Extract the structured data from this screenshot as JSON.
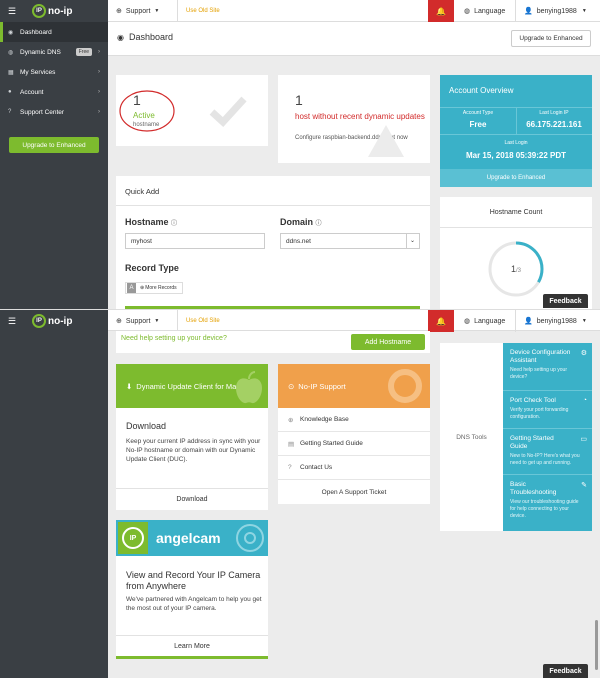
{
  "brand": {
    "logo_text": "no-ip",
    "logo_mark": "IP"
  },
  "topbar": {
    "support": "Support",
    "old_site": "Use Old Site",
    "language": "Language",
    "user": "benying1988"
  },
  "sidebar": {
    "items": [
      {
        "label": "Dashboard",
        "icon": "dashboard-icon"
      },
      {
        "label": "Dynamic DNS",
        "badge": "Free",
        "icon": "globe-icon"
      },
      {
        "label": "My Services",
        "icon": "grid-icon"
      },
      {
        "label": "Account",
        "icon": "user-icon"
      },
      {
        "label": "Support Center",
        "icon": "question-icon"
      }
    ],
    "upgrade": "Upgrade to Enhanced"
  },
  "header": {
    "title": "Dashboard",
    "upgrade": "Upgrade to Enhanced"
  },
  "active_card": {
    "count": "1",
    "label": "Active",
    "sub": "hostname"
  },
  "recent_card": {
    "count": "1",
    "title": "host without recent dynamic updates",
    "desc": "Configure raspbian-backend.ddns.net now"
  },
  "account": {
    "title": "Account Overview",
    "type_label": "Account Type",
    "type_value": "Free",
    "ip_label": "Last Login IP",
    "ip_value": "66.175.221.161",
    "login_label": "Last Login",
    "login_value": "Mar 15, 2018 05:39:22 PDT",
    "upgrade": "Upgrade to Enhanced"
  },
  "quick_add": {
    "title": "Quick Add",
    "hostname_label": "Hostname",
    "hostname_value": "myhost",
    "domain_label": "Domain",
    "domain_value": "ddns.net",
    "record_label": "Record Type",
    "record_type": "A",
    "more_records": "More Records"
  },
  "hostname_count": {
    "title": "Hostname Count",
    "used": "1",
    "total": "/3"
  },
  "feedback": "Feedback",
  "help": {
    "text": "Need help setting up your device?",
    "button": "Add Hostname"
  },
  "duc": {
    "title": "Dynamic Update Client for Mac",
    "heading": "Download",
    "desc": "Keep your current IP address in sync with your No-IP hostname or domain with our Dynamic Update Client (DUC).",
    "link": "Download"
  },
  "support": {
    "title": "No-IP Support",
    "items": [
      "Knowledge Base",
      "Getting Started Guide",
      "Contact Us"
    ],
    "ticket": "Open A Support Ticket"
  },
  "dns_tools": {
    "label": "DNS Tools",
    "items": [
      {
        "title": "Device Configuration Assistant",
        "desc": "Need help setting up your device?"
      },
      {
        "title": "Port Check Tool",
        "desc": "Verify your port forwarding configuration."
      },
      {
        "title": "Getting Started Guide",
        "desc": "New to No-IP? Here's what you need to get up and running."
      },
      {
        "title": "Basic Troubleshooting",
        "desc": "View our troubleshooting guide for help connecting to your device."
      }
    ]
  },
  "angelcam": {
    "brand": "angelcam",
    "title": "View and Record Your IP Camera from Anywhere",
    "desc": "We've partnered with Angelcam to help you get the most out of your IP camera.",
    "link": "Learn More"
  },
  "colors": {
    "green": "#7dbb2e",
    "teal": "#3ab1c8",
    "orange": "#f0a04b",
    "red": "#d22b2b",
    "sidebar": "#3a3f44"
  }
}
